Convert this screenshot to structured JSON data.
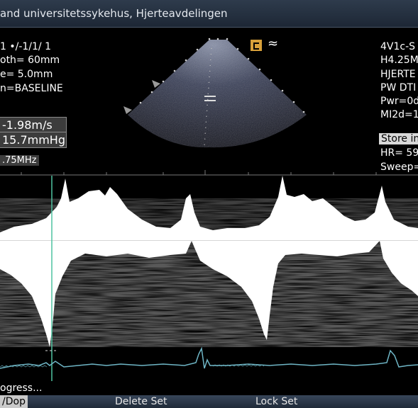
{
  "header": {
    "title": "and universitetssykehus, Hjerteavdelingen"
  },
  "left_params": {
    "line1": "1 •/-1/1/ 1",
    "line2": "oth=  60mm",
    "line3": "e=  5.0mm",
    "line4": "n=BASELINE"
  },
  "measurements": {
    "velocity": "-1.98m/s",
    "pressure": "15.7mmHg",
    "frequency": ".75MHz"
  },
  "right_params": {
    "probe": "4V1c-S",
    "freq": "H4.25MI",
    "preset": "HJERTE",
    "mode": "PW DTI",
    "power": "Pwr=0d",
    "index": "MI2d=1."
  },
  "store_label": "Store in",
  "vitals": {
    "hr": "HR=  59",
    "sweep": "Sweep="
  },
  "status": {
    "progress": "ogress..."
  },
  "softkeys": {
    "left": "/Dop",
    "delete_set": "Delete Set",
    "lock_set": "Lock Set"
  },
  "colors": {
    "background": "#000000",
    "ecg_trace": "#6fb6c6",
    "cursor": "#4fc3a1",
    "sector_dots": "#d0d0d0",
    "icon_accent": "#d8a03a"
  }
}
